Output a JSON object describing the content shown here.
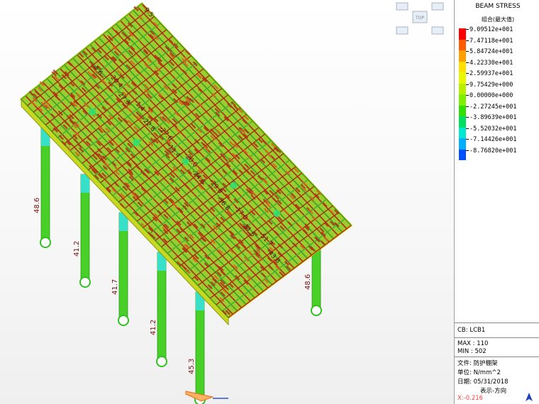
{
  "viewport": {
    "bar_labels": [
      "-4.6",
      "-20.4",
      "-27.3",
      "-1.4",
      "-22.8",
      "-27.6",
      "-11.4",
      "-20.0",
      "-24.6",
      "-29.8",
      "-36.8",
      "-17.0",
      "-31.5",
      "-51.7",
      "-43.8"
    ],
    "column_labels": [
      "48.6",
      "41.2",
      "41.7",
      "41.2",
      "45.3",
      "48.6"
    ],
    "top_number": "9.5"
  },
  "view_cube": {
    "top_label": "TOP"
  },
  "panel": {
    "title": "BEAM STRESS",
    "subtitle": "组合(最大值)",
    "legend": [
      {
        "value": "9.09512e+001",
        "color": "#ff0000"
      },
      {
        "value": "7.47118e+001",
        "color": "#ff5a00"
      },
      {
        "value": "5.84724e+001",
        "color": "#ffa000"
      },
      {
        "value": "4.22330e+001",
        "color": "#ffe000"
      },
      {
        "value": "2.59937e+001",
        "color": "#e8f800"
      },
      {
        "value": "9.75429e+000",
        "color": "#b8f000"
      },
      {
        "value": "0.00000e+000",
        "color": "#7cf000"
      },
      {
        "value": "-2.27245e+001",
        "color": "#30e000"
      },
      {
        "value": "-3.89639e+001",
        "color": "#00e060"
      },
      {
        "value": "-5.52032e+001",
        "color": "#00e8d0"
      },
      {
        "value": "-7.14426e+001",
        "color": "#00b0ff"
      },
      {
        "value": "-8.76820e+001",
        "color": "#0050ff"
      }
    ],
    "cb": "CB: LCB1",
    "max": "MAX : 110",
    "min": "MIN : 502",
    "file": "文件: 防护棚架",
    "unit": "单位: N/mm^2",
    "date": "日期: 05/31/2018",
    "direction": "表示-方向",
    "coord": "X:-0.216"
  }
}
